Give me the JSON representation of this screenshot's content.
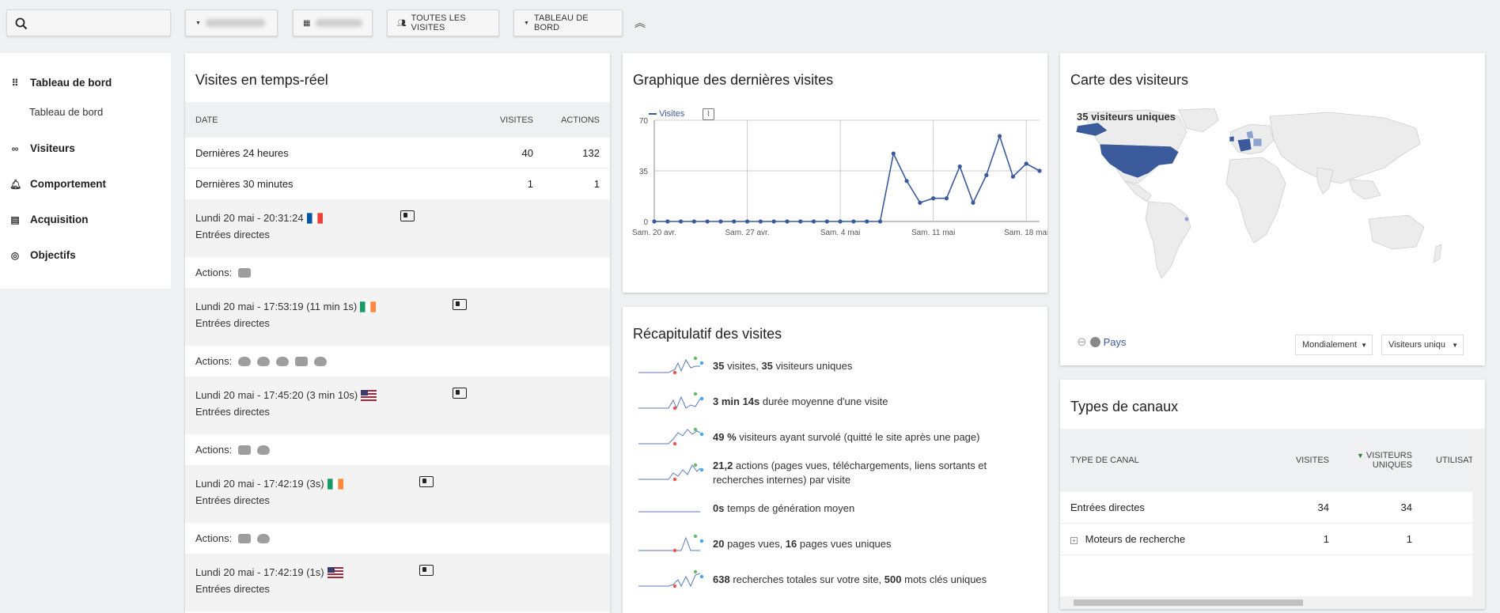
{
  "toolbar": {
    "all_visits": "TOUTES LES VISITES",
    "dashboard": "TABLEAU DE BORD"
  },
  "sidebar": {
    "items": [
      {
        "label": "Tableau de bord",
        "icon": "grid-icon"
      },
      {
        "label": "Tableau de bord",
        "icon": ""
      },
      {
        "label": "Visiteurs",
        "icon": "binoculars-icon"
      },
      {
        "label": "Comportement",
        "icon": "bell-icon"
      },
      {
        "label": "Acquisition",
        "icon": "acquisition-icon"
      },
      {
        "label": "Objectifs",
        "icon": "target-icon"
      }
    ]
  },
  "realtime": {
    "title": "Visites en temps-réel",
    "headers": {
      "date": "DATE",
      "visits": "VISITES",
      "actions": "ACTIONS"
    },
    "rows": [
      {
        "label": "Dernières 24 heures",
        "visits": "40",
        "actions": "132"
      },
      {
        "label": "Dernières 30 minutes",
        "visits": "1",
        "actions": "1"
      }
    ],
    "visits": [
      {
        "time": "Lundi 20 mai - 20:31:24",
        "flag": "france",
        "source": "Entrées directes",
        "actions_label": "Actions:"
      },
      {
        "time": "Lundi 20 mai - 17:53:19 (11 min 1s)",
        "flag": "ireland",
        "source": "Entrées directes",
        "actions_label": "Actions:"
      },
      {
        "time": "Lundi 20 mai - 17:45:20 (3 min 10s)",
        "flag": "usa",
        "source": "Entrées directes",
        "actions_label": "Actions:"
      },
      {
        "time": "Lundi 20 mai - 17:42:19 (3s)",
        "flag": "ireland",
        "source": "Entrées directes",
        "actions_label": "Actions:"
      },
      {
        "time": "Lundi 20 mai - 17:42:19 (1s)",
        "flag": "usa",
        "source": "Entrées directes",
        "actions_label": ""
      }
    ]
  },
  "graph": {
    "title": "Graphique des dernières visites"
  },
  "chart_data": {
    "type": "line",
    "series": [
      {
        "name": "Visites",
        "color": "#3a5a9b",
        "values": [
          0,
          0,
          0,
          0,
          0,
          0,
          0,
          0,
          0,
          0,
          0,
          0,
          0,
          0,
          0,
          0,
          0,
          0,
          47,
          28,
          13,
          16,
          16,
          38,
          13,
          32,
          59,
          31,
          40,
          35
        ]
      }
    ],
    "x_tick_labels": [
      "Sam. 20 avr.",
      "Sam. 27 avr.",
      "Sam. 4 mai",
      "Sam. 11 mai",
      "Sam. 18 mai"
    ],
    "y_tick_labels": [
      "70",
      "35",
      "0"
    ],
    "ylim": [
      0,
      70
    ],
    "grid": true,
    "legend": "top-left"
  },
  "summary": {
    "title": "Récapitulatif des visites",
    "items": [
      {
        "parts": [
          {
            "b": "35"
          },
          {
            "t": " visites, "
          },
          {
            "b": "35"
          },
          {
            "t": " visiteurs uniques"
          }
        ]
      },
      {
        "parts": [
          {
            "b": "3 min 14s"
          },
          {
            "t": " durée moyenne d'une visite"
          }
        ]
      },
      {
        "parts": [
          {
            "b": "49 %"
          },
          {
            "t": " visiteurs ayant survolé (quitté le site après une page)"
          }
        ]
      },
      {
        "parts": [
          {
            "b": "21,2"
          },
          {
            "t": " actions (pages vues, téléchargements, liens sortants et recherches internes) par visite"
          }
        ]
      },
      {
        "parts": [
          {
            "b": "0s"
          },
          {
            "t": " temps de génération moyen"
          }
        ]
      },
      {
        "parts": [
          {
            "b": "20"
          },
          {
            "t": " pages vues, "
          },
          {
            "b": "16"
          },
          {
            "t": " pages vues uniques"
          }
        ]
      },
      {
        "parts": [
          {
            "b": "638"
          },
          {
            "t": " recherches totales sur votre site, "
          },
          {
            "b": "500"
          },
          {
            "t": " mots clés uniques"
          }
        ]
      }
    ]
  },
  "map": {
    "title": "Carte des visiteurs",
    "unique_label": "35 visiteurs uniques",
    "country_link": "Pays",
    "region_select": "Mondialement",
    "metric_select": "Visiteurs uniqu"
  },
  "channels": {
    "title": "Types de canaux",
    "headers": {
      "type": "TYPE DE CANAL",
      "visits": "VISITES",
      "unique1": "VISITEURS",
      "unique2": "UNIQUES",
      "users": "UTILISATE"
    },
    "rows": [
      {
        "type": "Entrées directes",
        "visits": "34",
        "unique": "34"
      },
      {
        "type": "Moteurs de recherche",
        "visits": "1",
        "unique": "1"
      }
    ]
  }
}
